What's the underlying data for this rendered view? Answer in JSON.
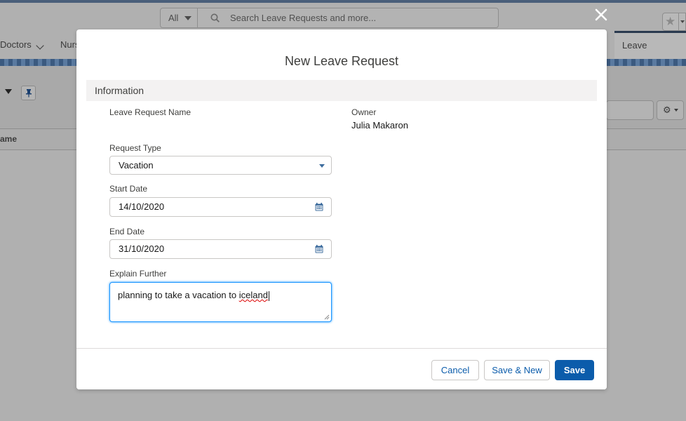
{
  "header": {
    "scope_label": "All",
    "search_placeholder": "Search Leave Requests and more..."
  },
  "nav": {
    "items": [
      {
        "label": "Doctors"
      },
      {
        "label": "Nurs"
      }
    ],
    "active_tab": "Leave Requests"
  },
  "list": {
    "column_header": "ame"
  },
  "modal": {
    "title": "New Leave Request",
    "section_title": "Information",
    "fields": {
      "leave_request_name": {
        "label": "Leave Request Name",
        "value": ""
      },
      "owner": {
        "label": "Owner",
        "value": "Julia Makaron"
      },
      "request_type": {
        "label": "Request Type",
        "value": "Vacation"
      },
      "start_date": {
        "label": "Start Date",
        "value": "14/10/2020"
      },
      "end_date": {
        "label": "End Date",
        "value": "31/10/2020"
      },
      "explain_further": {
        "label": "Explain Further",
        "value_prefix": "planning to take a vacation to ",
        "value_misspelled": "iceland"
      }
    },
    "buttons": {
      "cancel": "Cancel",
      "save_new": "Save & New",
      "save": "Save"
    }
  },
  "colors": {
    "brand": "#0b5cab",
    "focus": "#1b96ff",
    "overlay": "#b0b0b0"
  }
}
